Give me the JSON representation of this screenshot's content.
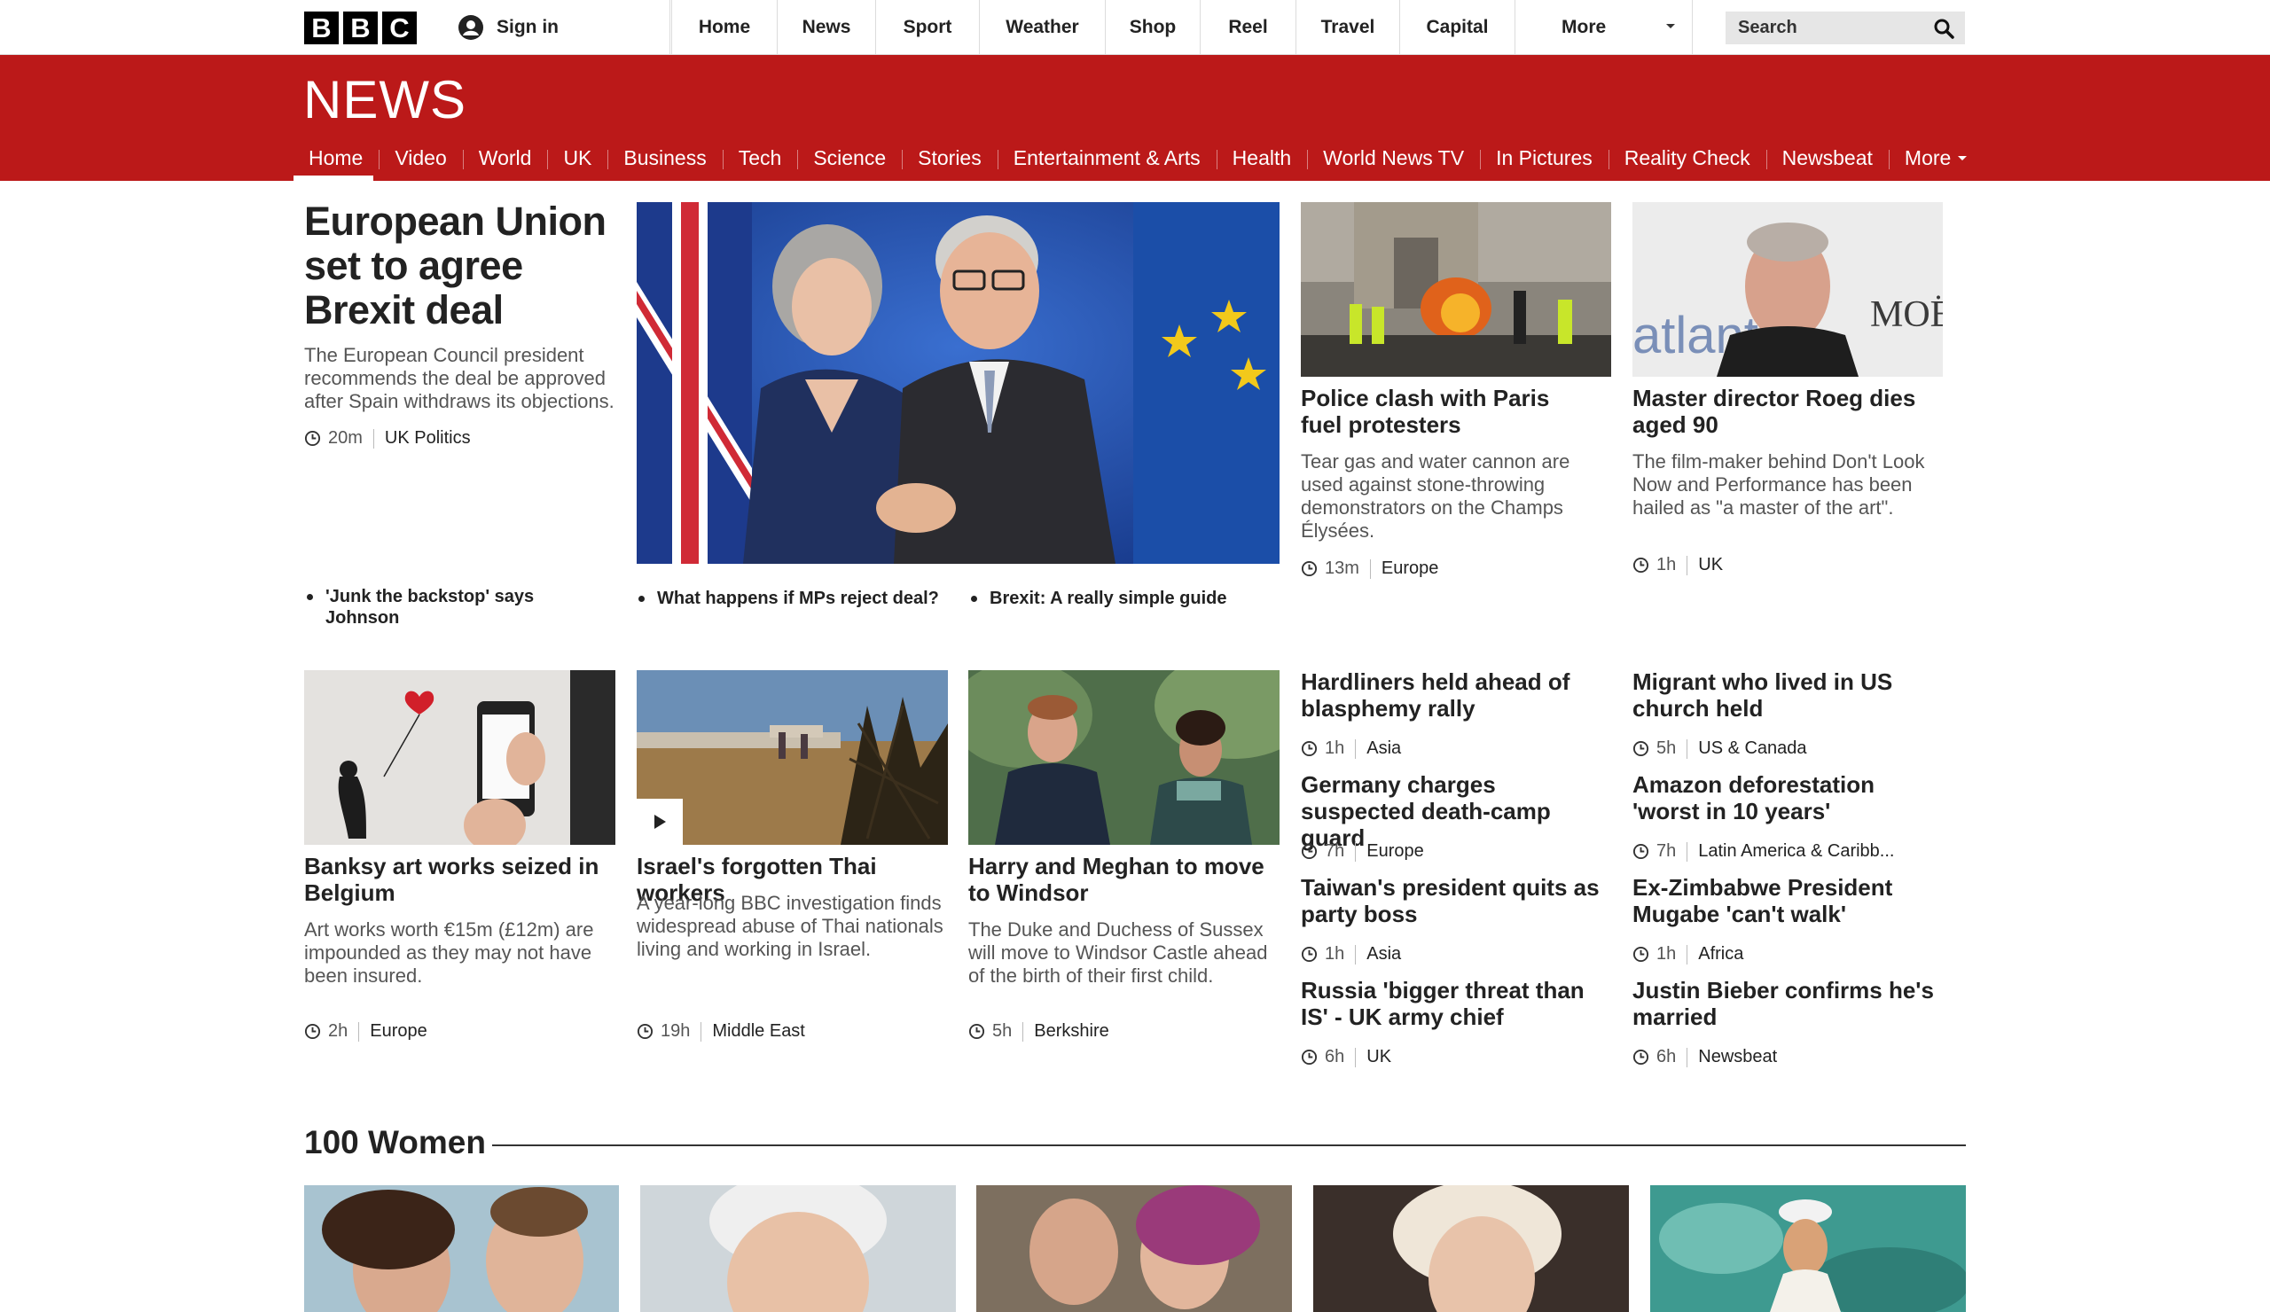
{
  "topbar": {
    "logo_letters": [
      "B",
      "B",
      "C"
    ],
    "signin_label": "Sign in",
    "nav": [
      "Home",
      "News",
      "Sport",
      "Weather",
      "Shop",
      "Reel",
      "Travel",
      "Capital",
      "More"
    ],
    "search_placeholder": "Search"
  },
  "newsband": {
    "title": "NEWS",
    "sections": [
      "Home",
      "Video",
      "World",
      "UK",
      "Business",
      "Tech",
      "Science",
      "Stories",
      "Entertainment & Arts",
      "Health",
      "World News TV",
      "In Pictures",
      "Reality Check",
      "Newsbeat",
      "More"
    ],
    "active_section": "Home"
  },
  "lead": {
    "headline": "European Union set to agree Brexit deal",
    "summary": "The European Council president recommends the deal be approved after Spain withdraws its objections.",
    "age": "20m",
    "tag": "UK Politics",
    "related": [
      "'Junk the backstop' says Johnson",
      "What happens if MPs reject deal?",
      "Brexit: A really simple guide"
    ]
  },
  "top_stories": [
    {
      "headline": "Police clash with Paris fuel protesters",
      "summary": "Tear gas and water cannon are used against stone-throwing demonstrators on the Champs Élysées.",
      "age": "13m",
      "tag": "Europe"
    },
    {
      "headline": "Master director Roeg dies aged 90",
      "summary": "The film-maker behind Don't Look Now and Performance has been hailed as \"a master of the art\".",
      "age": "1h",
      "tag": "UK"
    }
  ],
  "second_row": [
    {
      "headline": "Banksy art works seized in Belgium",
      "summary": "Art works worth €15m (£12m) are impounded as they may not have been insured.",
      "age": "2h",
      "tag": "Europe"
    },
    {
      "headline": "Israel's forgotten Thai workers",
      "summary": "A year-long BBC investigation finds widespread abuse of Thai nationals living and working in Israel.",
      "age": "19h",
      "tag": "Middle East"
    },
    {
      "headline": "Harry and Meghan to move to Windsor",
      "summary": "The Duke and Duchess of Sussex will move to Windsor Castle ahead of the birth of their first child.",
      "age": "5h",
      "tag": "Berkshire"
    }
  ],
  "headline_list_left": [
    {
      "headline": "Hardliners held ahead of blasphemy rally",
      "age": "1h",
      "tag": "Asia"
    },
    {
      "headline": "Germany charges suspected death-camp guard",
      "age": "7h",
      "tag": "Europe"
    },
    {
      "headline": "Taiwan's president quits as party boss",
      "age": "1h",
      "tag": "Asia"
    },
    {
      "headline": "Russia 'bigger threat than IS' - UK army chief",
      "age": "6h",
      "tag": "UK"
    }
  ],
  "headline_list_right": [
    {
      "headline": "Migrant who lived in US church held",
      "age": "5h",
      "tag": "US & Canada"
    },
    {
      "headline": "Amazon deforestation 'worst in 10 years'",
      "age": "7h",
      "tag": "Latin America & Caribb..."
    },
    {
      "headline": "Ex-Zimbabwe President Mugabe 'can't walk'",
      "age": "1h",
      "tag": "Africa"
    },
    {
      "headline": "Justin Bieber confirms he's married",
      "age": "6h",
      "tag": "Newsbeat"
    }
  ],
  "women_section": {
    "title": "100 Women"
  },
  "colors": {
    "brand_red": "#bb1919",
    "text": "#222222",
    "summary": "#555555"
  },
  "image_logo_text": {
    "atlantis": "atlant",
    "moet": "MOË"
  }
}
